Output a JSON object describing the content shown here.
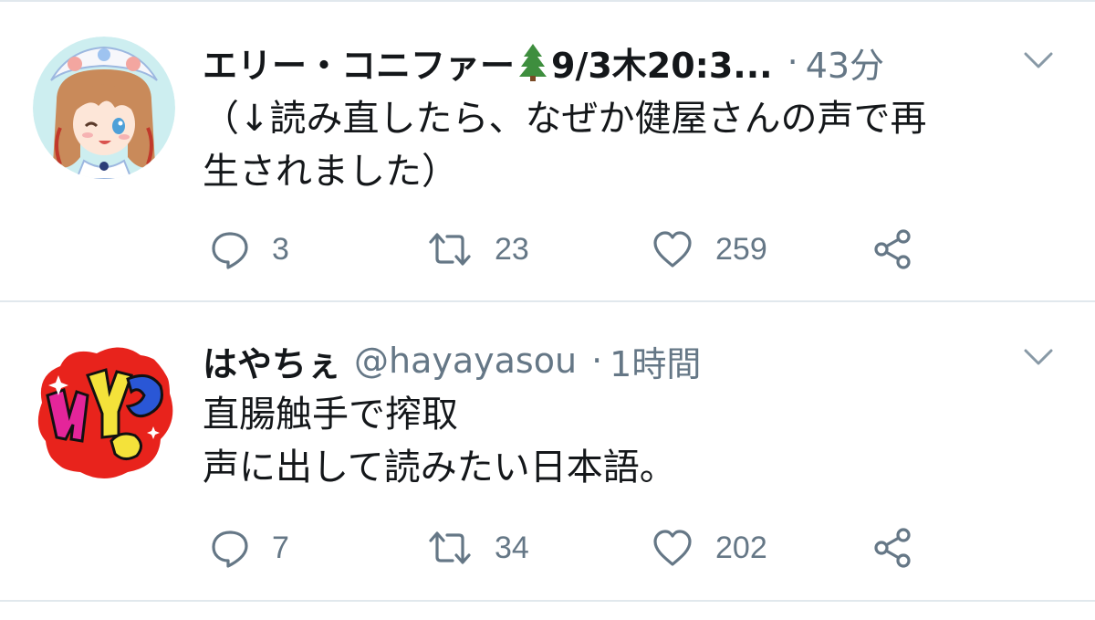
{
  "tweets": [
    {
      "display_name": "エリー・コニファー",
      "name_suffix": "9/3木20:3...",
      "handle": "",
      "separator": "·",
      "time": "43分",
      "text": "（↓読み直したら、なぜか健屋さんの声で再\n生されました）",
      "replies": "3",
      "retweets": "23",
      "likes": "259",
      "avatar_icon": "anime-girl-avatar",
      "name_emoji": "evergreen-tree-icon"
    },
    {
      "display_name": "はやちぇ",
      "name_suffix": "",
      "handle": "@hayayasou",
      "separator": "·",
      "time": "1時間",
      "text": "直腸触手で搾取\n声に出して読みたい日本語。",
      "replies": "7",
      "retweets": "34",
      "likes": "202",
      "avatar_icon": "graffiti-logo-avatar"
    }
  ],
  "colors": {
    "text_primary": "#14171a",
    "text_secondary": "#657786",
    "divider": "#e1e8ed"
  }
}
